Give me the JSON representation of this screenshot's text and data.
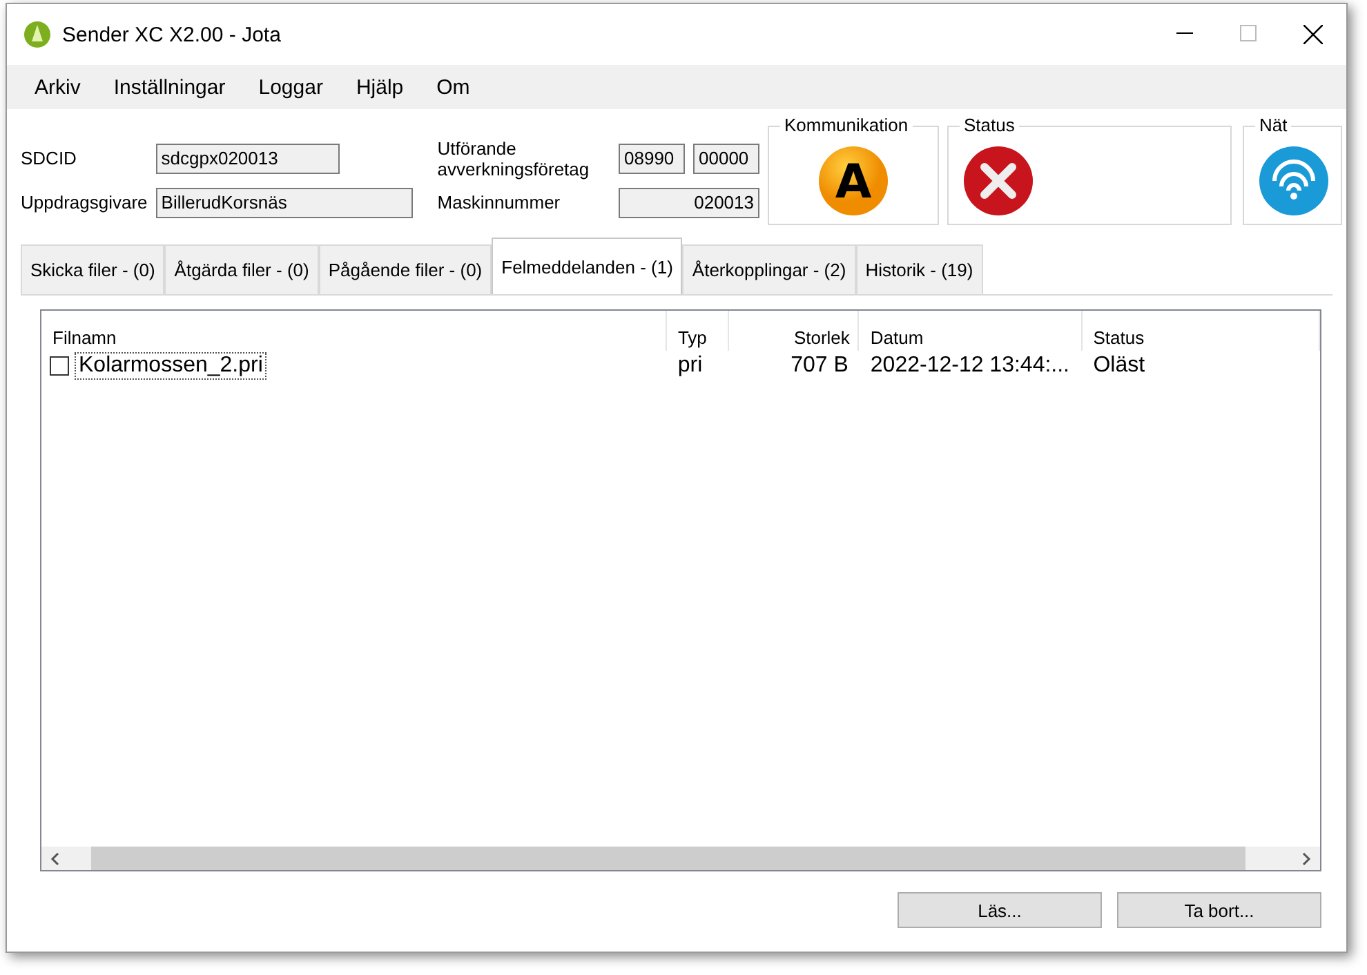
{
  "window": {
    "title": "Sender XC X2.00 - Jota"
  },
  "menu": [
    "Arkiv",
    "Inställningar",
    "Loggar",
    "Hjälp",
    "Om"
  ],
  "fields": {
    "sdcid_label": "SDCID",
    "sdcid": "sdcgpx020013",
    "company_label": "Utförande avverkningsföretag",
    "company_1": "08990",
    "company_2": "00000",
    "client_label": "Uppdragsgivare",
    "client": "BillerudKorsnäs",
    "machine_label": "Maskinnummer",
    "machine": "020013"
  },
  "indicators": [
    {
      "title": "Kommunikation",
      "kind": "letter",
      "letter": "A"
    },
    {
      "title": "Status",
      "kind": "error"
    },
    {
      "title": "Nät",
      "kind": "network"
    }
  ],
  "tabs": [
    {
      "label": "Skicka filer - (0)",
      "selected": false
    },
    {
      "label": "Åtgärda filer - (0)",
      "selected": false
    },
    {
      "label": "Pågående filer - (0)",
      "selected": false
    },
    {
      "label": "Felmeddelanden - (1)",
      "selected": true
    },
    {
      "label": "Återkopplingar - (2)",
      "selected": false
    },
    {
      "label": "Historik - (19)",
      "selected": false
    }
  ],
  "table": {
    "columns": [
      "Filnamn",
      "Typ",
      "Storlek",
      "Datum",
      "Status"
    ],
    "rows": [
      {
        "checked": false,
        "cells": [
          "Kolarmossen_2.pri",
          "pri",
          "707 B",
          "2022-12-12 13:44:...",
          "Oläst"
        ]
      }
    ]
  },
  "buttons": [
    "Läs...",
    "Ta bort..."
  ]
}
